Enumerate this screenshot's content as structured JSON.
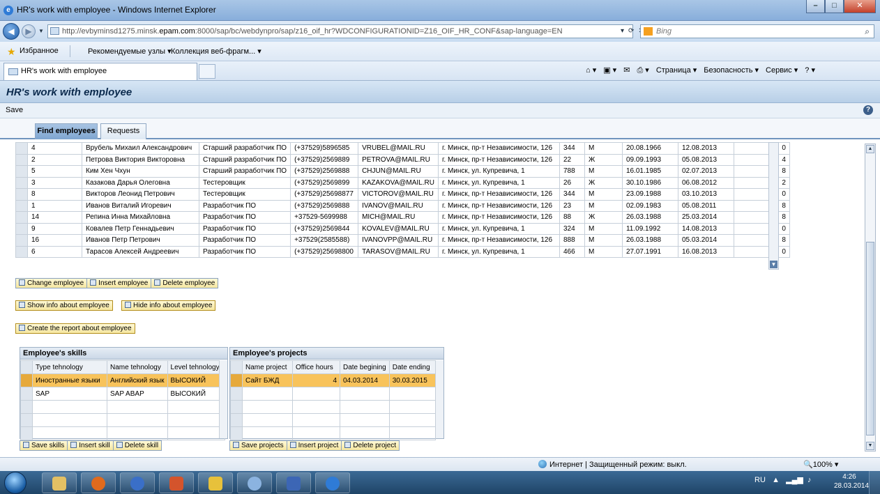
{
  "window": {
    "title": "HR's work with employee - Windows Internet Explorer",
    "url_prefix": "http://evbyminsd1275.minsk.",
    "url_host": "epam.com",
    "url_rest": ":8000/sap/bc/webdynpro/sap/z16_oif_hr?WDCONFIGURATIONID=Z16_OIF_HR_CONF&sap-language=EN",
    "search_placeholder": "Bing",
    "favorites": [
      "Избранное",
      "Рекомендуемые узлы ▾",
      "Коллекция веб-фрагм... ▾"
    ],
    "tab_title": "HR's work with employee",
    "commands": [
      "Страница ▾",
      "Безопасность ▾",
      "Сервис ▾"
    ]
  },
  "app": {
    "header": "HR's work with employee",
    "save_label": "Save",
    "tabs": [
      "Find employees",
      "Requests"
    ]
  },
  "employees": [
    [
      "4",
      "Врубель Михаил Александрович",
      "Старший разработчик ПО",
      "(+37529)5896585",
      "VRUBEL@MAIL.RU",
      "г. Минск, пр-т Независимости, 126",
      "344",
      "М",
      "20.08.1966",
      "12.08.2013",
      "0"
    ],
    [
      "2",
      "Петрова Виктория Викторовна",
      "Старший разработчик ПО",
      "(+37529)2569889",
      "PETROVA@MAIL.RU",
      "г. Минск, пр-т Независимости, 126",
      "22",
      "Ж",
      "09.09.1993",
      "05.08.2013",
      "4"
    ],
    [
      "5",
      "Ким Хен Чхун",
      "Старший разработчик ПО",
      "(+37529)2569888",
      "CHJUN@MAIL.RU",
      "г. Минск, ул. Купревича, 1",
      "788",
      "М",
      "16.01.1985",
      "02.07.2013",
      "8"
    ],
    [
      "3",
      "Казакова Дарья Олеговна",
      "Тестеровщик",
      "(+37529)2569899",
      "KAZAKOVA@MAIL.RU",
      "г. Минск, ул. Купревича, 1",
      "26",
      "Ж",
      "30.10.1986",
      "06.08.2012",
      "2"
    ],
    [
      "8",
      "Викторов Леонид Петрович",
      "Тестеровщик",
      "(+37529)25698877",
      "VICTOROV@MAIL.RU",
      "г. Минск, пр-т Независимости, 126",
      "344",
      "М",
      "23.09.1988",
      "03.10.2013",
      "0"
    ],
    [
      "1",
      "Иванов Виталий Игоревич",
      "Разработчик ПО",
      "(+37529)2569888",
      "IVANOV@MAIL.RU",
      "г. Минск, пр-т Независимости, 126",
      "23",
      "М",
      "02.09.1983",
      "05.08.2011",
      "8"
    ],
    [
      "14",
      "Репина Инна Михайловна",
      "Разработчик ПО",
      "+37529-5699988",
      "MICH@MAIL.RU",
      "г. Минск, пр-т Независимости, 126",
      "88",
      "Ж",
      "26.03.1988",
      "25.03.2014",
      "8"
    ],
    [
      "9",
      "Ковалев Петр Геннадьевич",
      "Разработчик ПО",
      "(+37529)2569844",
      "KOVALEV@MAIL.RU",
      "г. Минск, ул. Купревича, 1",
      "324",
      "М",
      "11.09.1992",
      "14.08.2013",
      "0"
    ],
    [
      "16",
      "Иванов Петр Петрович",
      "Разработчик ПО",
      "+37529(2585588)",
      "IVANOVPP@MAIL.RU",
      "г. Минск, пр-т Независимости, 126",
      "888",
      "М",
      "26.03.1988",
      "05.03.2014",
      "8"
    ],
    [
      "6",
      "Тарасов Алексей Андреевич",
      "Разработчик ПО",
      "(+37529)25698800",
      "TARASOV@MAIL.RU",
      "г. Минск, ул. Купревича, 1",
      "466",
      "М",
      "27.07.1991",
      "16.08.2013",
      "0"
    ]
  ],
  "employee_actions": {
    "change": "Change employee",
    "insert": "Insert employee",
    "delete": "Delete employee",
    "show_info": "Show info about employee",
    "hide_info": "Hide info about employee",
    "report": "Create the report about employee"
  },
  "skills": {
    "title": "Employee's skills",
    "columns": [
      "Type tehnology",
      "Name tehnology",
      "Level tehnology"
    ],
    "rows": [
      [
        "Иностранные языки",
        "Английский язык",
        "ВЫСОКИЙ"
      ],
      [
        "SAP",
        "SAP ABAP",
        "ВЫСОКИЙ"
      ]
    ],
    "save": "Save skills",
    "insert": "Insert skill",
    "delete": "Delete skill"
  },
  "projects": {
    "title": "Employee's projects",
    "columns": [
      "Name project",
      "Office hours",
      "Date begining",
      "Date ending"
    ],
    "rows": [
      [
        "Сайт БЖД",
        "4",
        "04.03.2014",
        "30.03.2015"
      ]
    ],
    "save": "Save projects",
    "insert": "Insert project",
    "delete": "Delete project"
  },
  "status": {
    "zone": "Интернет | Защищенный режим: выкл.",
    "zoom": "100%"
  },
  "taskbar": {
    "lang": "RU",
    "time": "4:26",
    "date": "28.03.2014"
  }
}
